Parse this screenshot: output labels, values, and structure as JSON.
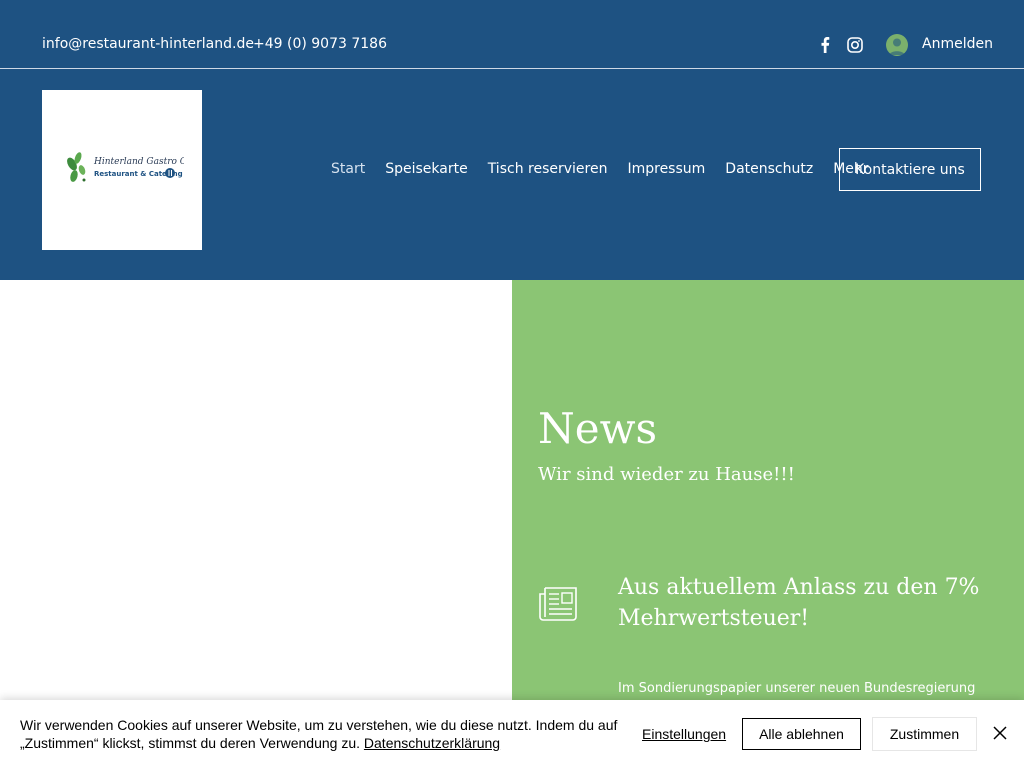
{
  "topbar": {
    "email": "info@restaurant-hinterland.de",
    "phone": "+49 (0) 9073 7186",
    "login_label": "Anmelden",
    "icons": [
      "facebook-icon",
      "instagram-icon",
      "user-avatar-icon"
    ]
  },
  "header": {
    "logo_script": "Hinterland Gastro GmbH",
    "logo_tagline": "Restaurant & Catering",
    "nav": [
      {
        "label": "Start"
      },
      {
        "label": "Speisekarte"
      },
      {
        "label": "Tisch reservieren"
      },
      {
        "label": "Impressum"
      },
      {
        "label": "Datenschutz"
      },
      {
        "label": "Mehr"
      }
    ],
    "contact_button": "Kontaktiere uns"
  },
  "news": {
    "title": "News",
    "subtitle": "Wir sind wieder zu Hause!!!",
    "article_title": "Aus aktuellem Anlass zu den 7% Mehrwertsteuer!",
    "article_text": "Im Sondierungspapier unserer neuen Bundesregierung"
  },
  "cookie": {
    "text": "Wir verwenden Cookies auf unserer Website, um zu verstehen, wie du diese nutzt. Indem du auf „Zustimmen“ klickst, stimmst du deren Verwendung zu.",
    "link": "Datenschutzerklärung",
    "settings": "Einstellungen",
    "reject": "Alle ablehnen",
    "accept": "Zustimmen"
  },
  "colors": {
    "header_blue": "#1e5282",
    "news_green": "#8bc574",
    "white": "#ffffff"
  }
}
